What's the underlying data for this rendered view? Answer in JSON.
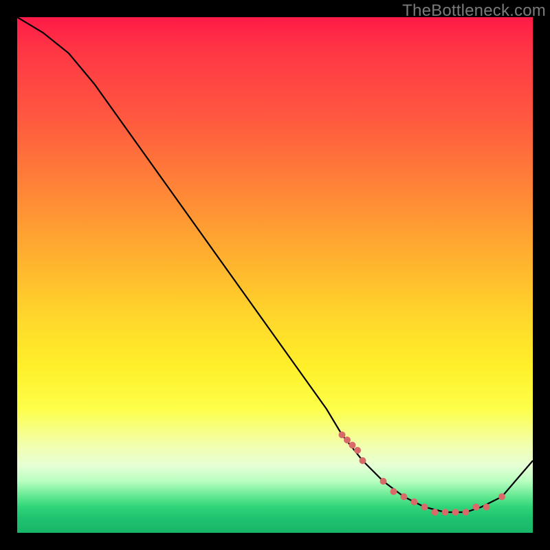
{
  "watermark": "TheBottleneck.com",
  "chart_data": {
    "type": "line",
    "title": "",
    "xlabel": "",
    "ylabel": "",
    "xlim": [
      0,
      100
    ],
    "ylim": [
      0,
      100
    ],
    "series": [
      {
        "name": "curve",
        "x": [
          0,
          5,
          10,
          15,
          20,
          25,
          30,
          35,
          40,
          45,
          50,
          55,
          60,
          63,
          67,
          71,
          75,
          79,
          83,
          87,
          90,
          94,
          100
        ],
        "y": [
          100,
          97,
          93,
          87,
          80,
          73,
          66,
          59,
          52,
          45,
          38,
          31,
          24,
          19,
          14,
          10,
          7,
          5,
          4,
          4,
          5,
          7,
          14
        ]
      }
    ],
    "markers": {
      "comment": "dashed/dotted salmon marker run along the trough",
      "x": [
        63,
        64,
        65,
        66,
        67,
        71,
        73,
        75,
        77,
        79,
        81,
        83,
        85,
        87,
        89,
        91,
        94
      ],
      "y": [
        19,
        18,
        17,
        16,
        14,
        10,
        8,
        7,
        6,
        5,
        4,
        4,
        4,
        4,
        5,
        5,
        7
      ]
    },
    "colors": {
      "curve": "#000000",
      "markers": "#d86a6a"
    }
  }
}
